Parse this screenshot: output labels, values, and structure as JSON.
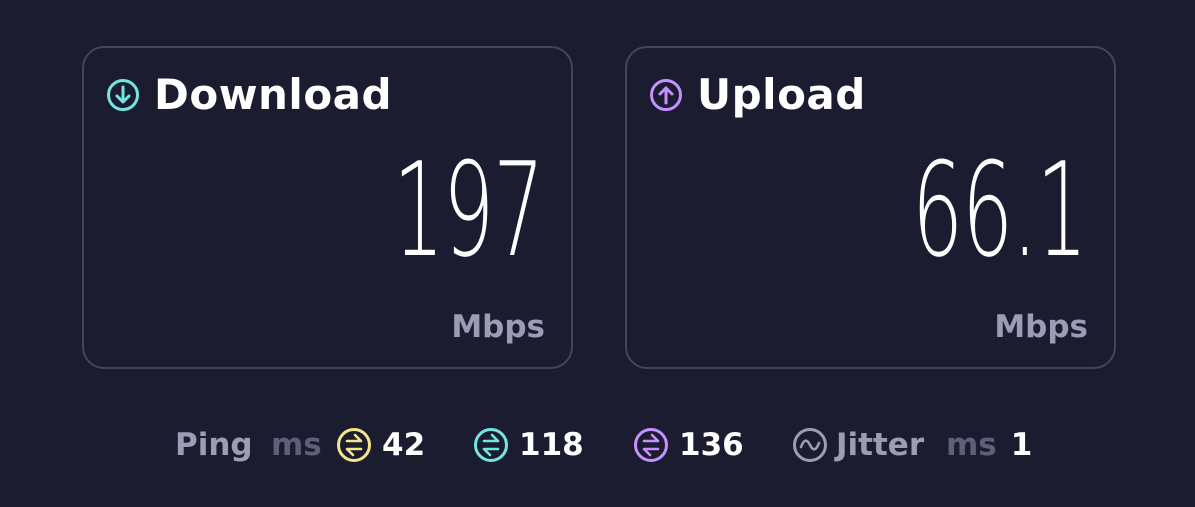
{
  "colors": {
    "background": "#1b1c2f",
    "card_border": "#44455a",
    "download_accent": "#74e6e1",
    "upload_accent": "#c590ff",
    "idle_ping_accent": "#f2e58a",
    "muted_label": "#9c9db4",
    "dim_unit": "#5e5f78"
  },
  "download": {
    "title": "Download",
    "value": "197",
    "unit": "Mbps",
    "icon": "arrow-down-circle-icon"
  },
  "upload": {
    "title": "Upload",
    "value": "66.1",
    "unit": "Mbps",
    "icon": "arrow-up-circle-icon"
  },
  "stats": {
    "ping_label": "Ping",
    "ping_unit": "ms",
    "ping_idle": "42",
    "ping_download": "118",
    "ping_upload": "136",
    "jitter_label": "Jitter",
    "jitter_unit": "ms",
    "jitter_value": "1"
  }
}
